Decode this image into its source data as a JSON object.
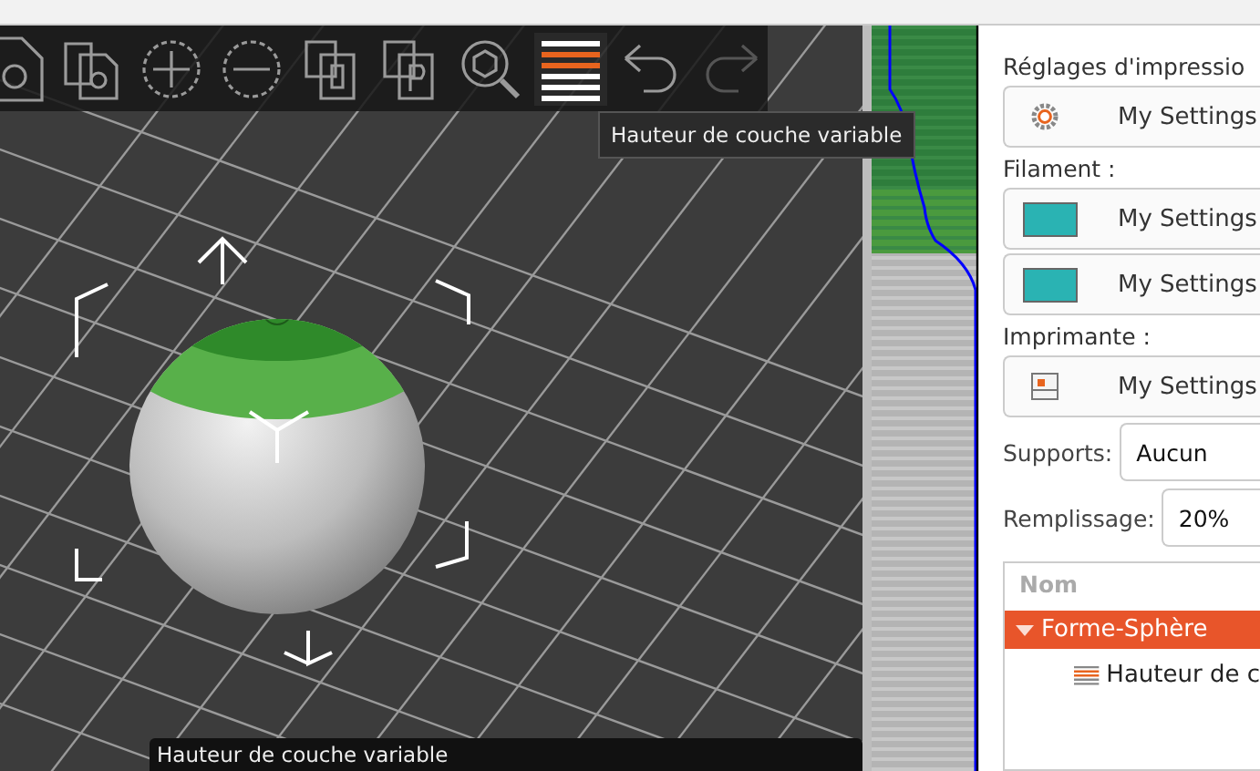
{
  "viewport": {
    "toolbar": [
      {
        "kind": "paste",
        "selected": false,
        "disabled": false
      },
      {
        "kind": "copy",
        "selected": false,
        "disabled": false
      },
      {
        "kind": "add",
        "selected": false,
        "disabled": false
      },
      {
        "kind": "remove",
        "selected": false,
        "disabled": false
      },
      {
        "kind": "split-objects",
        "selected": false,
        "disabled": false
      },
      {
        "kind": "split-parts",
        "selected": false,
        "disabled": false
      },
      {
        "kind": "search",
        "selected": false,
        "disabled": false
      },
      {
        "kind": "layers",
        "selected": true,
        "disabled": false
      },
      {
        "kind": "undo",
        "selected": false,
        "disabled": false
      },
      {
        "kind": "redo",
        "selected": false,
        "disabled": true
      }
    ],
    "toolbar_tooltip": "Hauteur de couche variable",
    "bottom_tooltip": "Hauteur de couche variable"
  },
  "sidebar": {
    "print_settings": {
      "label": "Réglages d'impressio",
      "value": "My Settings"
    },
    "filament": {
      "label": "Filament :",
      "items": [
        {
          "value": "My Settings",
          "color": "#2ab3b3"
        },
        {
          "value": "My Settings",
          "color": "#2ab3b3"
        }
      ]
    },
    "printer": {
      "label": "Imprimante :",
      "value": "My Settings"
    },
    "supports": {
      "label": "Supports:",
      "value": "Aucun"
    },
    "infill": {
      "label": "Remplissage:",
      "value": "20%"
    },
    "objects": {
      "header": "Nom",
      "items": [
        {
          "name": "Forme-Sphère",
          "selected": true,
          "expanded": true,
          "children": [
            {
              "name": "Hauteur de c",
              "selected": false
            }
          ]
        }
      ]
    }
  }
}
